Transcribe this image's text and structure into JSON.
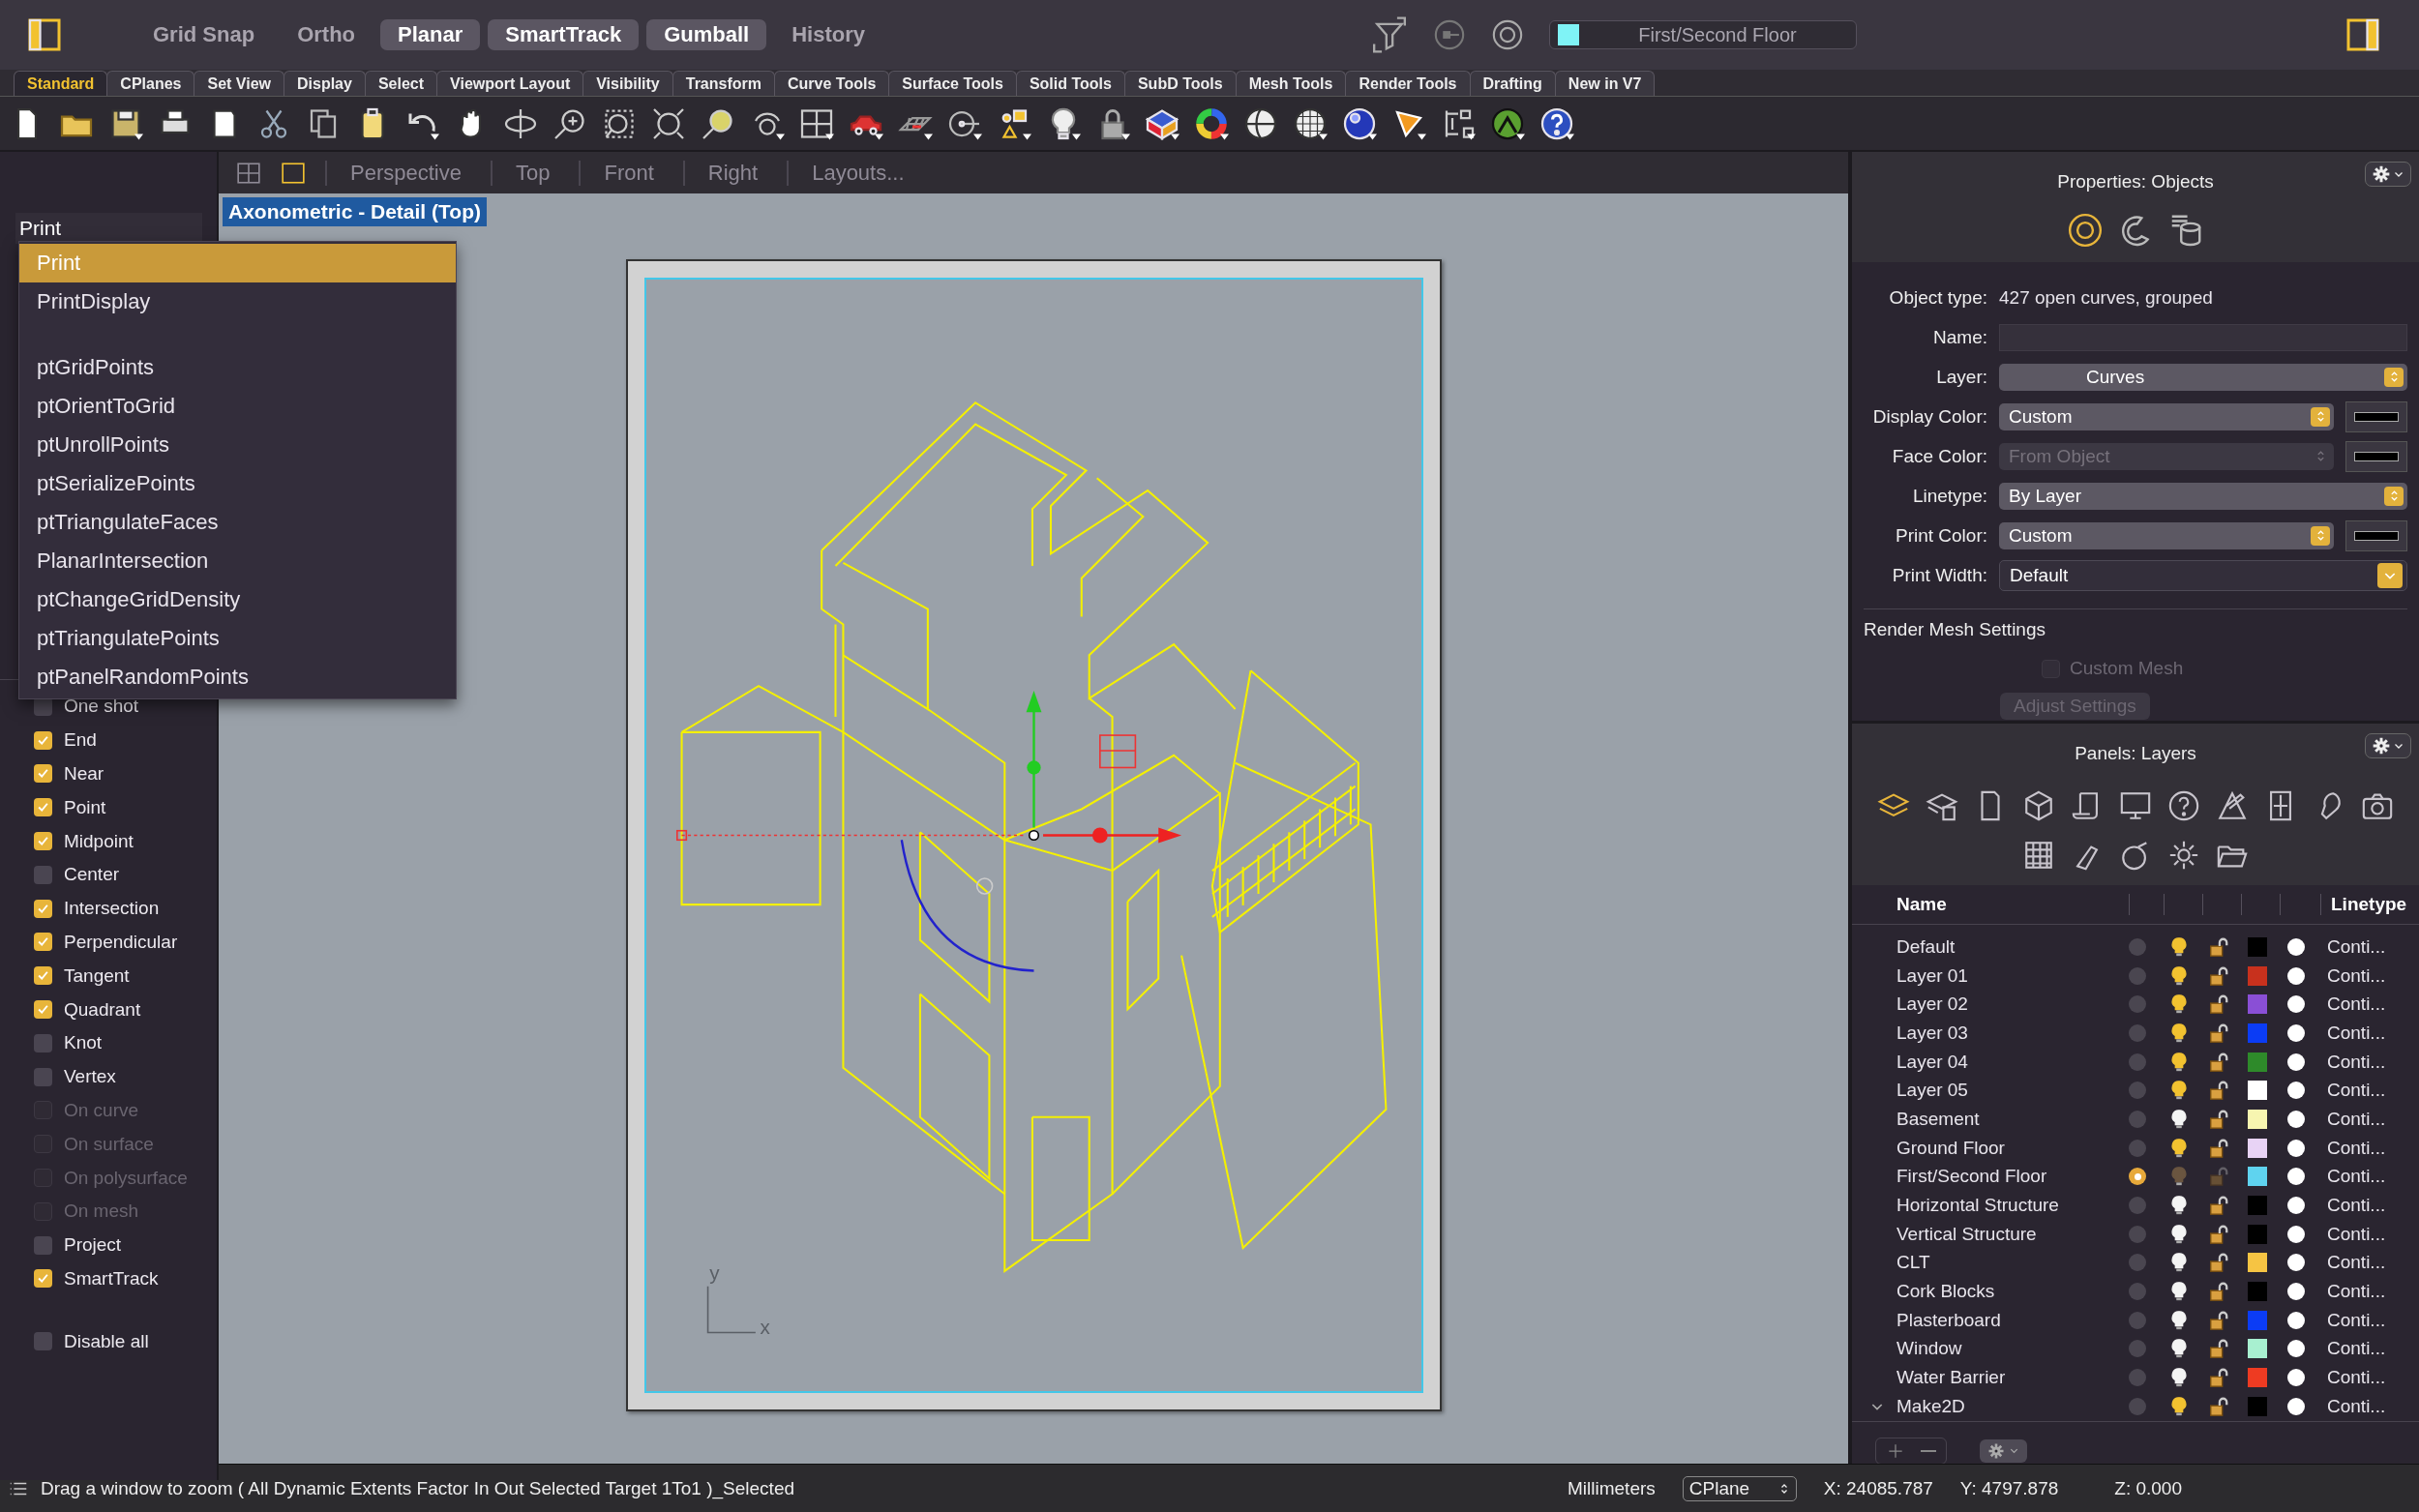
{
  "top_bar": {
    "toggles": [
      {
        "label": "Grid Snap",
        "on": false
      },
      {
        "label": "Ortho",
        "on": false
      },
      {
        "label": "Planar",
        "on": true
      },
      {
        "label": "SmartTrack",
        "on": true
      },
      {
        "label": "Gumball",
        "on": true
      },
      {
        "label": "History",
        "on": false
      }
    ],
    "current_layer": {
      "name": "First/Second Floor",
      "color": "#7ff3f6"
    }
  },
  "ribbon_tabs": [
    {
      "label": "Standard",
      "selected": true
    },
    {
      "label": "CPlanes",
      "selected": false
    },
    {
      "label": "Set View",
      "selected": false
    },
    {
      "label": "Display",
      "selected": false
    },
    {
      "label": "Select",
      "selected": false
    },
    {
      "label": "Viewport Layout",
      "selected": false
    },
    {
      "label": "Visibility",
      "selected": false
    },
    {
      "label": "Transform",
      "selected": false
    },
    {
      "label": "Curve Tools",
      "selected": false
    },
    {
      "label": "Surface Tools",
      "selected": false
    },
    {
      "label": "Solid Tools",
      "selected": false
    },
    {
      "label": "SubD Tools",
      "selected": false
    },
    {
      "label": "Mesh Tools",
      "selected": false
    },
    {
      "label": "Render Tools",
      "selected": false
    },
    {
      "label": "Drafting",
      "selected": false
    },
    {
      "label": "New in V7",
      "selected": false
    }
  ],
  "command": {
    "value": "Print",
    "autocomplete": [
      [
        {
          "label": "Print",
          "selected": true
        },
        {
          "label": "PrintDisplay",
          "selected": false
        }
      ],
      [
        {
          "label": "ptGridPoints",
          "selected": false
        },
        {
          "label": "ptOrientToGrid",
          "selected": false
        },
        {
          "label": "ptUnrollPoints",
          "selected": false
        },
        {
          "label": "ptSerializePoints",
          "selected": false
        },
        {
          "label": "ptTriangulateFaces",
          "selected": false
        },
        {
          "label": "PlanarIntersection",
          "selected": false
        },
        {
          "label": "ptChangeGridDensity",
          "selected": false
        },
        {
          "label": "ptTriangulatePoints",
          "selected": false
        },
        {
          "label": "ptPanelRandomPoints",
          "selected": false
        }
      ]
    ]
  },
  "osnaps": [
    {
      "label": "One shot",
      "checked": false,
      "disabled": false
    },
    {
      "label": "End",
      "checked": true,
      "disabled": false
    },
    {
      "label": "Near",
      "checked": true,
      "disabled": false
    },
    {
      "label": "Point",
      "checked": true,
      "disabled": false
    },
    {
      "label": "Midpoint",
      "checked": true,
      "disabled": false
    },
    {
      "label": "Center",
      "checked": false,
      "disabled": false
    },
    {
      "label": "Intersection",
      "checked": true,
      "disabled": false
    },
    {
      "label": "Perpendicular",
      "checked": true,
      "disabled": false
    },
    {
      "label": "Tangent",
      "checked": true,
      "disabled": false
    },
    {
      "label": "Quadrant",
      "checked": true,
      "disabled": false
    },
    {
      "label": "Knot",
      "checked": false,
      "disabled": false
    },
    {
      "label": "Vertex",
      "checked": false,
      "disabled": false
    },
    {
      "label": "On curve",
      "checked": false,
      "disabled": true
    },
    {
      "label": "On surface",
      "checked": false,
      "disabled": true
    },
    {
      "label": "On polysurface",
      "checked": false,
      "disabled": true
    },
    {
      "label": "On mesh",
      "checked": false,
      "disabled": true
    },
    {
      "label": "Project",
      "checked": false,
      "disabled": false
    },
    {
      "label": "SmartTrack",
      "checked": true,
      "disabled": false
    }
  ],
  "disable_all": {
    "label": "Disable all",
    "checked": false
  },
  "viewport": {
    "tabs": [
      "Perspective",
      "Top",
      "Front",
      "Right",
      "Layouts..."
    ],
    "title": "Axonometric - Detail (Top)",
    "axis_x": "x",
    "axis_y": "y"
  },
  "properties": {
    "title": "Properties: Objects",
    "object_type_label": "Object type:",
    "object_type": "427 open curves, grouped",
    "fields": [
      {
        "kind": "text",
        "label": "Name:",
        "disabled": false
      },
      {
        "kind": "layer",
        "label": "Layer:",
        "value": "Curves",
        "disabled": false
      },
      {
        "kind": "select_swatch",
        "label": "Display Color:",
        "value": "Custom",
        "color": "#000000",
        "disabled": false
      },
      {
        "kind": "select_swatch",
        "label": "Face Color:",
        "value": "From Object",
        "color": "#000000",
        "disabled": true
      },
      {
        "kind": "select",
        "label": "Linetype:",
        "value": "By Layer",
        "disabled": false
      },
      {
        "kind": "select_swatch",
        "label": "Print Color:",
        "value": "Custom",
        "color": "#000000",
        "disabled": false
      },
      {
        "kind": "combo",
        "label": "Print Width:",
        "value": "Default",
        "disabled": false
      }
    ],
    "section": "Render Mesh Settings",
    "custom_mesh": {
      "label": "Custom Mesh",
      "checked": false,
      "disabled": true
    },
    "adjust_button": {
      "label": "Adjust Settings",
      "disabled": true
    }
  },
  "layers": {
    "title": "Panels: Layers",
    "columns": [
      "Name",
      "Linetype"
    ],
    "rows": [
      {
        "name": "Default",
        "current": false,
        "visible": true,
        "color": "#000000",
        "linetype": "Conti..."
      },
      {
        "name": "Layer 01",
        "current": false,
        "visible": true,
        "color": "#c8311d",
        "linetype": "Conti..."
      },
      {
        "name": "Layer 02",
        "current": false,
        "visible": true,
        "color": "#8a4fd6",
        "linetype": "Conti..."
      },
      {
        "name": "Layer 03",
        "current": false,
        "visible": true,
        "color": "#0b3cf5",
        "linetype": "Conti..."
      },
      {
        "name": "Layer 04",
        "current": false,
        "visible": true,
        "color": "#2e8a2a",
        "linetype": "Conti..."
      },
      {
        "name": "Layer 05",
        "current": false,
        "visible": true,
        "color": "#ffffff",
        "linetype": "Conti..."
      },
      {
        "name": "Basement",
        "current": false,
        "visible": false,
        "color": "#f7f5b0",
        "linetype": "Conti..."
      },
      {
        "name": "Ground Floor",
        "current": false,
        "visible": true,
        "color": "#e8d3f5",
        "linetype": "Conti..."
      },
      {
        "name": "First/Second Floor",
        "current": true,
        "visible": true,
        "color": "#5fd3ef",
        "linetype": "Conti..."
      },
      {
        "name": "Horizontal Structure",
        "current": false,
        "visible": false,
        "color": "#000000",
        "linetype": "Conti..."
      },
      {
        "name": "Vertical Structure",
        "current": false,
        "visible": false,
        "color": "#000000",
        "linetype": "Conti..."
      },
      {
        "name": "CLT",
        "current": false,
        "visible": false,
        "color": "#f6c443",
        "linetype": "Conti..."
      },
      {
        "name": "Cork Blocks",
        "current": false,
        "visible": false,
        "color": "#000000",
        "linetype": "Conti..."
      },
      {
        "name": "Plasterboard",
        "current": false,
        "visible": false,
        "color": "#0b3cf5",
        "linetype": "Conti..."
      },
      {
        "name": "Window",
        "current": false,
        "visible": false,
        "color": "#a8f0d0",
        "linetype": "Conti..."
      },
      {
        "name": "Water Barrier",
        "current": false,
        "visible": false,
        "color": "#ee3b22",
        "linetype": "Conti..."
      },
      {
        "name": "Make2D",
        "current": false,
        "visible": true,
        "color": "#000000",
        "linetype": "Conti...",
        "expanded": true
      }
    ]
  },
  "status_bar": {
    "message": "Drag a window to zoom ( All Dynamic Extents Factor In Out Selected Target 1To1 )_Selected",
    "units": "Millimeters",
    "cplane": "CPlane",
    "x": "X: 24085.787",
    "y": "Y: 4797.878",
    "z": "Z: 0.000"
  }
}
